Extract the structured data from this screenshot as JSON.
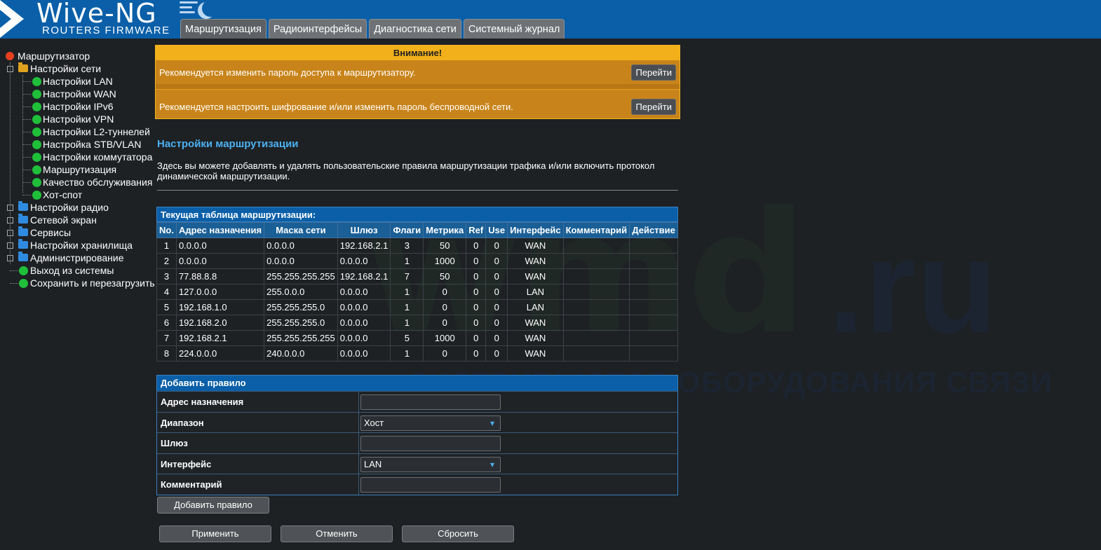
{
  "brand": {
    "title": "Wive-NG",
    "subtitle": "ROUTERS FIRMWARE"
  },
  "tabs": [
    {
      "label": "Маршрутизация"
    },
    {
      "label": "Радиоинтерфейсы"
    },
    {
      "label": "Диагностика сети"
    },
    {
      "label": "Системный журнал"
    }
  ],
  "tree": {
    "root": "Маршрутизатор",
    "network": "Настройки сети",
    "network_items": [
      "Настройки LAN",
      "Настройки WAN",
      "Настройки IPv6",
      "Настройки VPN",
      "Настройки L2-туннелей",
      "Настройка STB/VLAN",
      "Настройки коммутатора",
      "Маршрутизация",
      "Качество обслуживания",
      "Хот-спот"
    ],
    "radio": "Настройки радио",
    "firewall": "Сетевой экран",
    "services": "Сервисы",
    "storage": "Настройки хранилища",
    "admin": "Администрирование",
    "logout": "Выход из системы",
    "save_reboot": "Сохранить и перезагрузить"
  },
  "alert": {
    "title": "Внимание!",
    "msg1": "Рекомендуется изменить пароль доступа к маршрутизатору.",
    "msg2": "Рекомендуется настроить шифрование и/или изменить пароль беспроводной сети.",
    "go_label": "Перейти"
  },
  "section": {
    "title": "Настройки маршрутизации",
    "description": "Здесь вы можете добавлять и удалять пользовательские правила маршрутизации трафика и/или включить протокол динамической маршрутизации."
  },
  "routes": {
    "caption": "Текущая таблица маршрутизации:",
    "headers": [
      "No.",
      "Адрес назначения",
      "Маска сети",
      "Шлюз",
      "Флаги",
      "Метрика",
      "Ref",
      "Use",
      "Интерфейс",
      "Комментарий",
      "Действие"
    ],
    "rows": [
      [
        "1",
        "0.0.0.0",
        "0.0.0.0",
        "192.168.2.1",
        "3",
        "50",
        "0",
        "0",
        "WAN",
        "",
        ""
      ],
      [
        "2",
        "0.0.0.0",
        "0.0.0.0",
        "0.0.0.0",
        "1",
        "1000",
        "0",
        "0",
        "WAN",
        "",
        ""
      ],
      [
        "3",
        "77.88.8.8",
        "255.255.255.255",
        "192.168.2.1",
        "7",
        "50",
        "0",
        "0",
        "WAN",
        "",
        ""
      ],
      [
        "4",
        "127.0.0.0",
        "255.0.0.0",
        "0.0.0.0",
        "1",
        "0",
        "0",
        "0",
        "LAN",
        "",
        ""
      ],
      [
        "5",
        "192.168.1.0",
        "255.255.255.0",
        "0.0.0.0",
        "1",
        "0",
        "0",
        "0",
        "LAN",
        "",
        ""
      ],
      [
        "6",
        "192.168.2.0",
        "255.255.255.0",
        "0.0.0.0",
        "1",
        "0",
        "0",
        "0",
        "WAN",
        "",
        ""
      ],
      [
        "7",
        "192.168.2.1",
        "255.255.255.255",
        "0.0.0.0",
        "5",
        "1000",
        "0",
        "0",
        "WAN",
        "",
        ""
      ],
      [
        "8",
        "224.0.0.0",
        "240.0.0.0",
        "0.0.0.0",
        "1",
        "0",
        "0",
        "0",
        "WAN",
        "",
        ""
      ]
    ]
  },
  "add_rule": {
    "title": "Добавить правило",
    "dest_label": "Адрес назначения",
    "dest_value": "",
    "range_label": "Диапазон",
    "range_value": "Хост",
    "gateway_label": "Шлюз",
    "gateway_value": "",
    "iface_label": "Интерфейс",
    "iface_value": "LAN",
    "comment_label": "Комментарий",
    "comment_value": "",
    "add_button": "Добавить правило"
  },
  "actions": {
    "apply": "Применить",
    "cancel": "Отменить",
    "reset": "Сбросить"
  },
  "watermark": {
    "main": "wmd",
    "domain": ".ru",
    "tagline": "ДИСТРИБЬЮТОР ОБОРУДОВАНИЯ СВЯЗИ"
  }
}
